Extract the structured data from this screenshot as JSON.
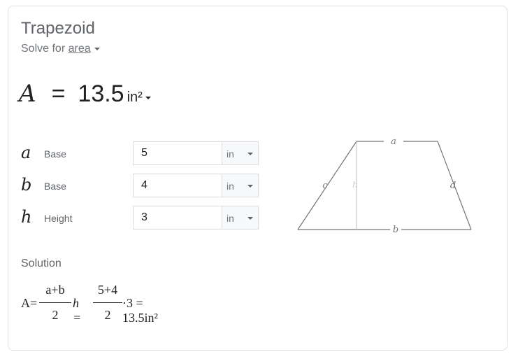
{
  "card": {
    "title": "Trapezoid",
    "solve_prefix": "Solve for",
    "solve_target": "area"
  },
  "result": {
    "variable": "A",
    "equals": "=",
    "value": "13.5",
    "unit": "in²"
  },
  "inputs": [
    {
      "symbol": "a",
      "label": "Base",
      "value": "5",
      "unit": "in"
    },
    {
      "symbol": "b",
      "label": "Base",
      "value": "4",
      "unit": "in"
    },
    {
      "symbol": "h",
      "label": "Height",
      "value": "3",
      "unit": "in"
    }
  ],
  "diagram": {
    "labels": {
      "a": "a",
      "b": "b",
      "c": "c",
      "d": "d",
      "h": "h"
    }
  },
  "solution": {
    "heading": "Solution",
    "lhs": "A=",
    "frac1_num": "a+b",
    "frac1_den": "2",
    "h_eq": "h =",
    "frac2_num": "5+4",
    "frac2_den": "2",
    "tail": "·3 = 13.5in²"
  },
  "colors": {
    "border": "#dfe1e5",
    "title": "#5f6368",
    "text": "#202124",
    "diagram_line": "#757575"
  }
}
